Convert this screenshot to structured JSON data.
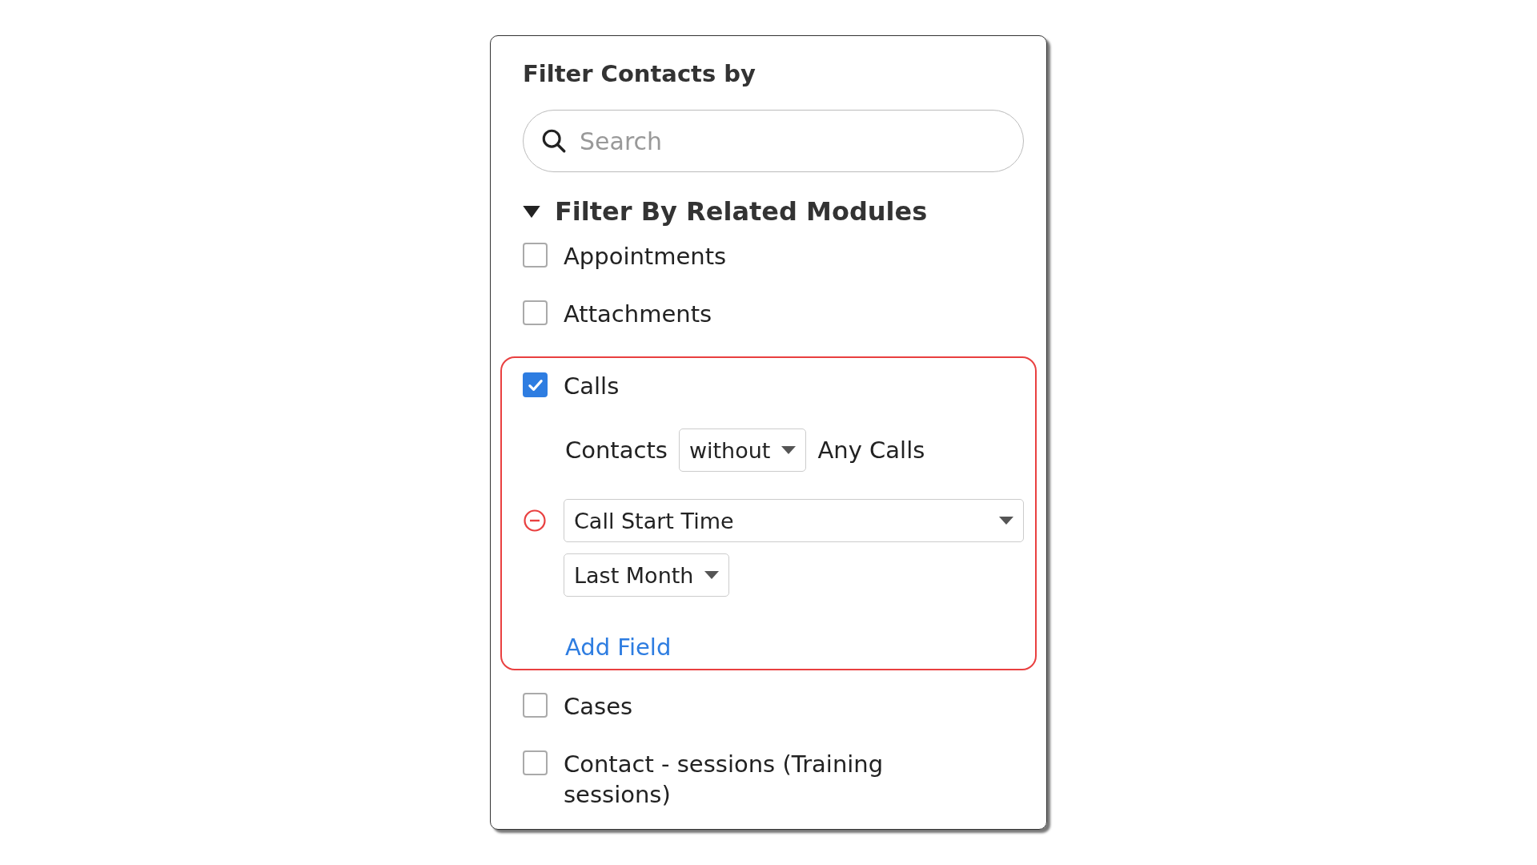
{
  "panel": {
    "title": "Filter Contacts by",
    "search": {
      "placeholder": "Search"
    },
    "section": {
      "title": "Filter By Related Modules",
      "expanded": true
    },
    "modules": [
      {
        "label": "Appointments",
        "checked": false,
        "highlighted": false
      },
      {
        "label": "Attachments",
        "checked": false,
        "highlighted": false
      },
      {
        "label": "Calls",
        "checked": true,
        "highlighted": true,
        "condition": {
          "prefix": "Contacts",
          "operator": "without",
          "suffix": "Any Calls"
        },
        "fields": [
          {
            "field": "Call Start Time",
            "value": "Last Month"
          }
        ],
        "add_link": "Add Field"
      },
      {
        "label": "Cases",
        "checked": false,
        "highlighted": false
      },
      {
        "label": "Contact - sessions (Training sessions)",
        "checked": false,
        "highlighted": false
      }
    ]
  }
}
